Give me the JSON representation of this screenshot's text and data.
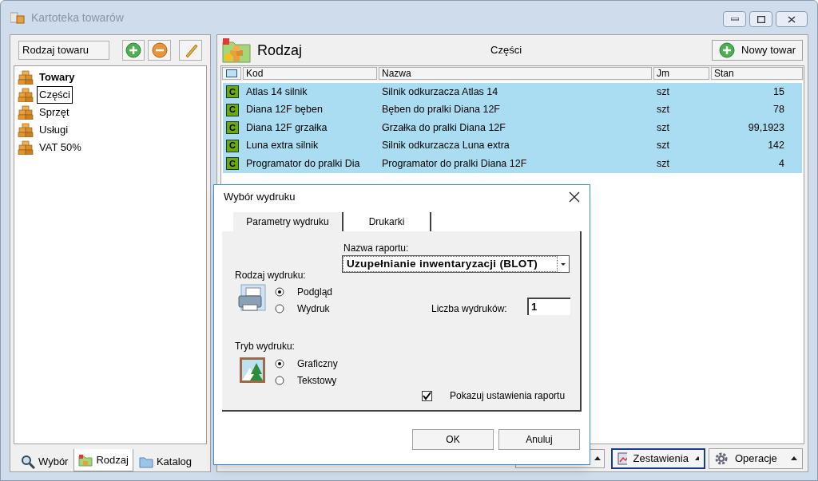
{
  "window": {
    "title": "Kartoteka towarów"
  },
  "left_panel": {
    "kind_field": "Rodzaj towaru",
    "tree": [
      {
        "label": "Towary",
        "bold": true,
        "selected": false,
        "children": [
          {
            "label": "Części",
            "bold": false,
            "selected": true
          },
          {
            "label": "Sprzęt",
            "bold": false,
            "selected": false
          },
          {
            "label": "Usługi",
            "bold": false,
            "selected": false
          },
          {
            "label": "VAT 50%",
            "bold": false,
            "selected": false
          }
        ]
      }
    ],
    "tabs": [
      {
        "label": "Wybór",
        "selected": false
      },
      {
        "label": "Rodzaj",
        "selected": true
      },
      {
        "label": "Katalog",
        "selected": false
      }
    ]
  },
  "right_panel": {
    "title": "Rodzaj",
    "subtitle": "Części",
    "new_button": "Nowy towar",
    "table": {
      "columns": [
        "Kod",
        "Nazwa",
        "Jm",
        "Stan"
      ],
      "rows": [
        {
          "badge": "C",
          "selected": true,
          "cells": [
            "Atlas 14 silnik",
            "Silnik odkurzacza Atlas 14",
            "szt",
            "15"
          ]
        },
        {
          "badge": "C",
          "selected": true,
          "cells": [
            "Diana 12F bęben",
            "Bęben do pralki Diana 12F",
            "szt",
            "78"
          ]
        },
        {
          "badge": "C",
          "selected": true,
          "cells": [
            "Diana 12F grzałka",
            "Grzałka do pralki Diana 12F",
            "szt",
            "99,1923"
          ]
        },
        {
          "badge": "C",
          "selected": true,
          "cells": [
            "Luna extra silnik",
            "Silnik odkurzacza Luna extra",
            "szt",
            "142"
          ]
        },
        {
          "badge": "C",
          "selected": true,
          "cells": [
            "Programator do pralki Dia",
            "Programator do pralki Diana 12F",
            "szt",
            "4"
          ]
        }
      ]
    },
    "bottom_buttons": [
      {
        "label": "Zestawienia",
        "focused": true
      },
      {
        "label": "Operacje",
        "focused": false
      }
    ]
  },
  "dialog": {
    "title": "Wybór wydruku",
    "tabs": [
      {
        "label": "Parametry wydruku",
        "selected": true
      },
      {
        "label": "Drukarki",
        "selected": false
      }
    ],
    "report_label": "Nazwa raportu:",
    "report_value": "Uzupełnianie inwentaryzacji (BLOT)",
    "print_kind_label": "Rodzaj wydruku:",
    "print_kind": [
      {
        "label": "Podgląd",
        "selected": true
      },
      {
        "label": "Wydruk",
        "selected": false
      }
    ],
    "copies_label": "Liczba wydruków:",
    "copies": "1",
    "mode_label": "Tryb wydruku:",
    "mode": [
      {
        "label": "Graficzny",
        "selected": true
      },
      {
        "label": "Tekstowy",
        "selected": false
      }
    ],
    "show_settings": {
      "label": "Pokazuj ustawienia raportu",
      "checked": true
    },
    "buttons": [
      "OK",
      "Anuluj"
    ]
  }
}
